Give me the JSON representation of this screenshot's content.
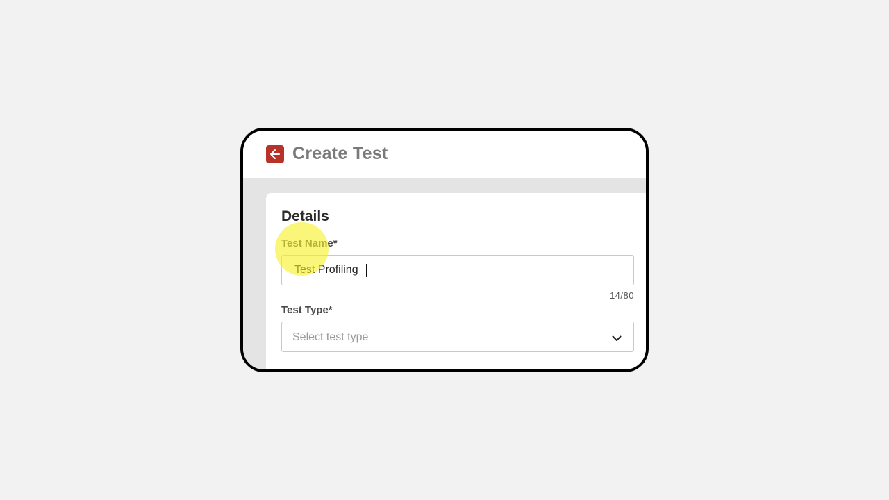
{
  "header": {
    "title": "Create Test",
    "back_icon": "arrow-left-icon",
    "back_color": "#b83229"
  },
  "details": {
    "section_title": "Details",
    "test_name": {
      "label": "Test Name*",
      "value": "Test Profiling",
      "counter": "14/80"
    },
    "test_type": {
      "label": "Test Type*",
      "placeholder": "Select test type",
      "icon": "chevron-down-icon"
    }
  }
}
